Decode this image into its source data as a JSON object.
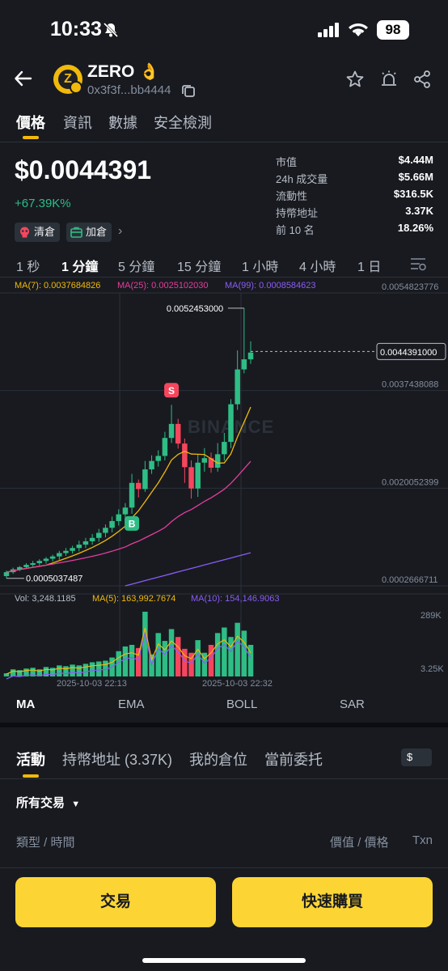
{
  "status_bar": {
    "time": "10:33",
    "battery": "98"
  },
  "token": {
    "name": "ZERO",
    "emoji": "👌",
    "address": "0x3f3f...bb4444",
    "logo_letter": "Z"
  },
  "tabs": [
    "價格",
    "資訊",
    "數據",
    "安全檢測"
  ],
  "price": {
    "value": "$0.0044391",
    "change": "+67.39K%"
  },
  "chips": [
    {
      "label": "清倉",
      "icon": "skull-icon"
    },
    {
      "label": "加倉",
      "icon": "bag-icon"
    }
  ],
  "stats": [
    {
      "label": "市值",
      "value": "$4.44M"
    },
    {
      "label": "24h 成交量",
      "value": "$5.66M"
    },
    {
      "label": "流動性",
      "value": "$316.5K"
    },
    {
      "label": "持幣地址",
      "value": "3.37K"
    },
    {
      "label": "前 10 名",
      "value": "18.26%"
    }
  ],
  "intervals": [
    "1 秒",
    "1 分鐘",
    "5 分鐘",
    "15 分鐘",
    "1 小時",
    "4 小時",
    "1 日"
  ],
  "ma_legend": {
    "ma7": "MA(7): 0.0037684826",
    "ma25": "MA(25): 0.0025102030",
    "ma99": "MA(99): 0.0008584623"
  },
  "colors": {
    "up": "#2ebd85",
    "down": "#f6465d",
    "ma7": "#f0b90b",
    "ma25": "#e63d9e",
    "ma99": "#8b5cf6",
    "accent": "#fcd535"
  },
  "chart_data": {
    "type": "candlestick",
    "y_ticks": [
      "0.0054823776",
      "0.0037438088",
      "0.0020052399",
      "0.0002666711"
    ],
    "y_tick_values": [
      0.0054823776,
      0.0037438088,
      0.0020052399,
      0.0002666711
    ],
    "current_price_label": "0.0044391000",
    "current_price": 0.0044391,
    "high_label": "0.0052453000",
    "low_label": "0.0005037487",
    "watermark": "BINANCE",
    "markers": [
      {
        "label": "S"
      },
      {
        "label": "B"
      }
    ],
    "x_labels": [
      "2025-10-03 22:13",
      "2025-10-03 22:32"
    ],
    "candles": [
      [
        0.00044,
        0.00051,
        0.00054,
        0.0004
      ],
      [
        0.00051,
        0.00056,
        0.00059,
        0.00048
      ],
      [
        0.00056,
        0.0006,
        0.00062,
        0.00053
      ],
      [
        0.0006,
        0.00064,
        0.00067,
        0.00057
      ],
      [
        0.00064,
        0.00067,
        0.00071,
        0.00061
      ],
      [
        0.00067,
        0.00071,
        0.00074,
        0.00063
      ],
      [
        0.00071,
        0.00075,
        0.00078,
        0.00066
      ],
      [
        0.00075,
        0.00079,
        0.00082,
        0.0007
      ],
      [
        0.00079,
        0.00085,
        0.00089,
        0.00073
      ],
      [
        0.00085,
        0.00089,
        0.00094,
        0.0008
      ],
      [
        0.00089,
        0.00094,
        0.00098,
        0.00084
      ],
      [
        0.00094,
        0.001,
        0.00107,
        0.00088
      ],
      [
        0.001,
        0.00106,
        0.00112,
        0.00094
      ],
      [
        0.00106,
        0.00112,
        0.00119,
        0.001
      ],
      [
        0.00112,
        0.00121,
        0.00128,
        0.00105
      ],
      [
        0.00121,
        0.0013,
        0.00136,
        0.00113
      ],
      [
        0.0013,
        0.00142,
        0.0015,
        0.00122
      ],
      [
        0.00142,
        0.00154,
        0.00163,
        0.00134
      ],
      [
        0.00154,
        0.00166,
        0.00174,
        0.00145
      ],
      [
        0.00166,
        0.0021,
        0.00226,
        0.00155
      ],
      [
        0.0021,
        0.00199,
        0.00216,
        0.00184
      ],
      [
        0.00199,
        0.00234,
        0.00249,
        0.00194
      ],
      [
        0.00234,
        0.00249,
        0.00259,
        0.00226
      ],
      [
        0.00249,
        0.00258,
        0.00268,
        0.00239
      ],
      [
        0.00258,
        0.0029,
        0.00301,
        0.0025
      ],
      [
        0.0029,
        0.00315,
        0.00349,
        0.00281
      ],
      [
        0.00315,
        0.0028,
        0.00324,
        0.00271
      ],
      [
        0.0028,
        0.00238,
        0.00289,
        0.0021
      ],
      [
        0.00238,
        0.002,
        0.0025,
        0.00182
      ],
      [
        0.002,
        0.00246,
        0.00261,
        0.00185
      ],
      [
        0.00246,
        0.00254,
        0.00272,
        0.0023
      ],
      [
        0.00254,
        0.00237,
        0.00264,
        0.00228
      ],
      [
        0.00237,
        0.00261,
        0.00281,
        0.0023
      ],
      [
        0.00261,
        0.00283,
        0.00299,
        0.0025
      ],
      [
        0.00283,
        0.0035,
        0.00359,
        0.00272
      ],
      [
        0.0035,
        0.00412,
        0.00446,
        0.0034
      ],
      [
        0.00412,
        0.0043,
        0.00521,
        0.00405
      ],
      [
        0.0043,
        0.00442,
        0.00462,
        0.00422
      ]
    ],
    "volume": {
      "label": "Vol: 3,248.1185",
      "ma5": "MA(5): 163,992.7674",
      "ma10": "MA(10): 154,146.9063",
      "ticks": [
        "289K",
        "3.25K"
      ],
      "bars": [
        4,
        9,
        8,
        10,
        11,
        9,
        12,
        11,
        14,
        13,
        15,
        14,
        16,
        18,
        19,
        20,
        24,
        32,
        38,
        40,
        36,
        82,
        28,
        55,
        45,
        60,
        50,
        35,
        30,
        46,
        30,
        40,
        55,
        62,
        50,
        68,
        58,
        40
      ]
    }
  },
  "indicators": [
    "MA",
    "EMA",
    "BOLL",
    "SAR"
  ],
  "bottom_tabs": [
    "活動",
    "持幣地址 (3.37K)",
    "我的倉位",
    "當前委托"
  ],
  "currency": "$",
  "filter_label": "所有交易",
  "columns": {
    "left": "類型 / 時間",
    "mid": "價值 / 價格",
    "right": "Txn"
  },
  "buttons": {
    "trade": "交易",
    "quick_buy": "快速購買"
  }
}
